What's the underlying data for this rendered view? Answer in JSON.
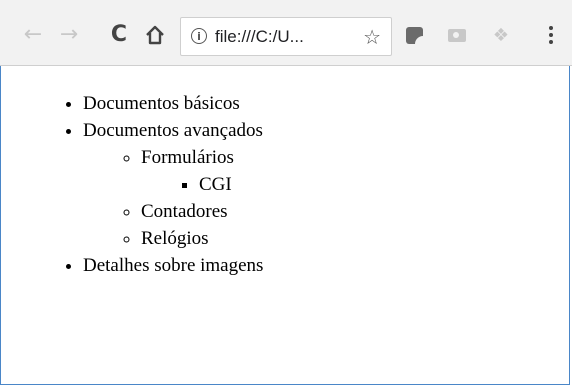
{
  "browser": {
    "address_bar": {
      "url": "file:///C:/U..."
    },
    "icons": {
      "back": "arrow-left-icon",
      "forward": "arrow-right-icon",
      "reload": "reload-icon",
      "home": "home-icon",
      "info": "info-icon",
      "bookmark": "star-icon",
      "extension_1": "pocket-like-extension-icon",
      "extension_2": "camera-extension-icon",
      "extension_3": "dropbox-extension-icon",
      "menu": "kebab-menu-icon"
    },
    "glyphs": {
      "back": "←",
      "forward": "→",
      "reload": "C",
      "home": "⌂",
      "info": "i",
      "star": "☆",
      "dropbox": "❖"
    },
    "colors": {
      "frame": "#4a86c8",
      "toolbar": "#f2f2f2"
    }
  },
  "page": {
    "list": {
      "item1": "Documentos básicos",
      "item2": "Documentos avançados",
      "sub1": "Formulários",
      "subsub1": "CGI",
      "sub2": "Contadores",
      "sub3": "Relógios",
      "item3": "Detalhes sobre imagens"
    }
  }
}
